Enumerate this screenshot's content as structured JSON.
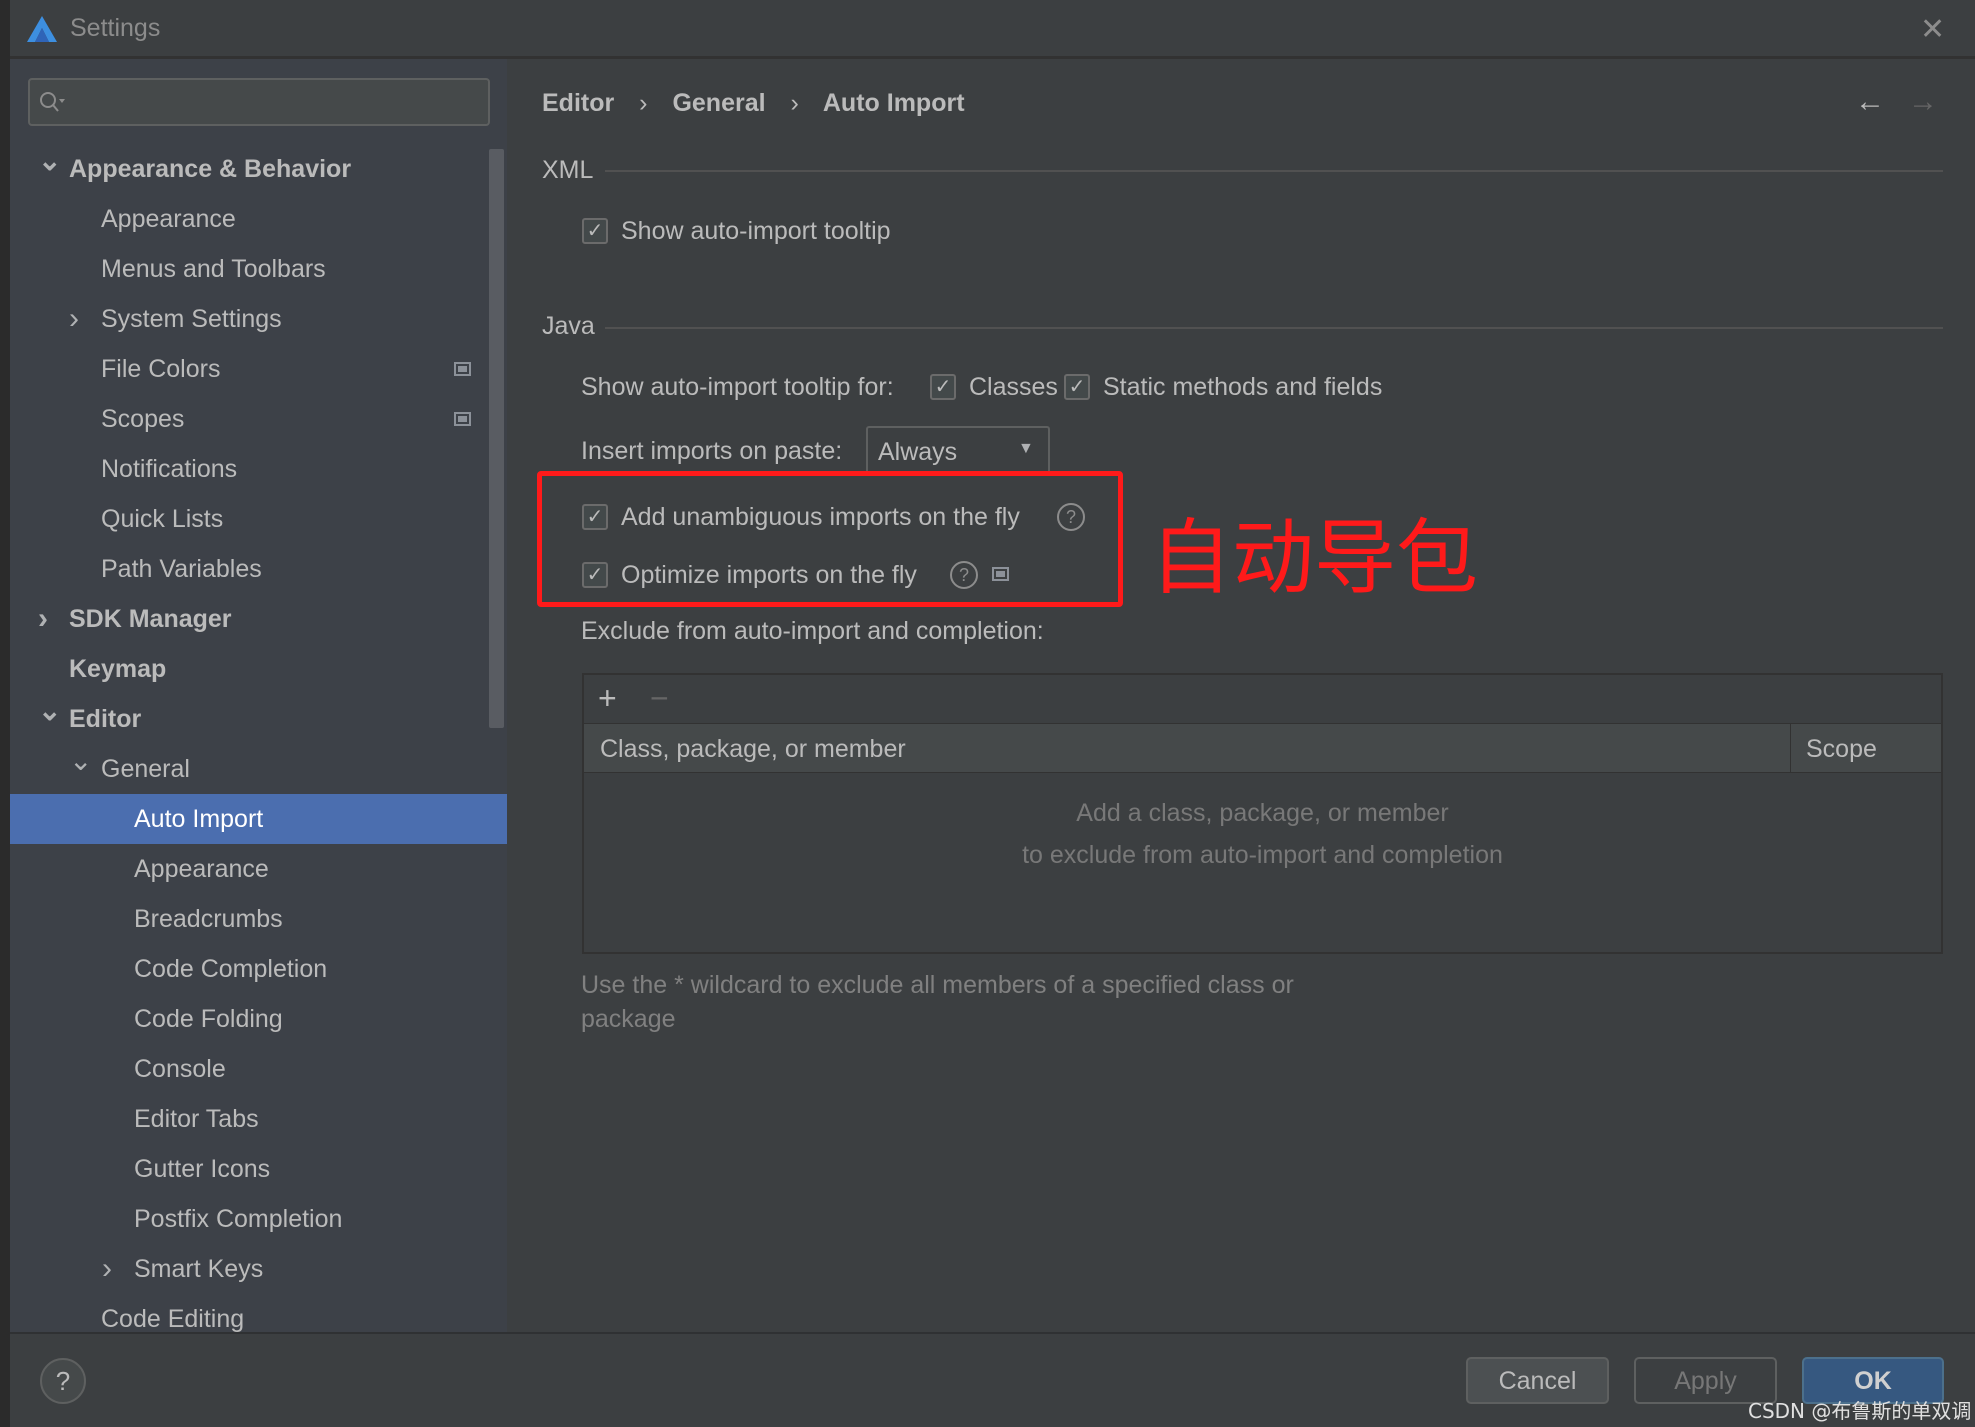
{
  "window": {
    "title": "Settings",
    "close_icon": "close-icon"
  },
  "search": {
    "placeholder": "",
    "value": ""
  },
  "sidebar": {
    "items": [
      {
        "label": "Appearance & Behavior",
        "level": 0,
        "bold": true,
        "arrow": "expanded"
      },
      {
        "label": "Appearance",
        "level": 1
      },
      {
        "label": "Menus and Toolbars",
        "level": 1
      },
      {
        "label": "System Settings",
        "level": 1,
        "arrow": "collapsed"
      },
      {
        "label": "File Colors",
        "level": 1,
        "icon": "project-scope-icon"
      },
      {
        "label": "Scopes",
        "level": 1,
        "icon": "project-scope-icon"
      },
      {
        "label": "Notifications",
        "level": 1
      },
      {
        "label": "Quick Lists",
        "level": 1
      },
      {
        "label": "Path Variables",
        "level": 1
      },
      {
        "label": "SDK Manager",
        "level": 0,
        "bold": true,
        "arrow": "collapsed"
      },
      {
        "label": "Keymap",
        "level": 0,
        "bold": true
      },
      {
        "label": "Editor",
        "level": 0,
        "bold": true,
        "arrow": "expanded"
      },
      {
        "label": "General",
        "level": 1,
        "arrow": "expanded"
      },
      {
        "label": "Auto Import",
        "level": 2,
        "selected": true
      },
      {
        "label": "Appearance",
        "level": 2
      },
      {
        "label": "Breadcrumbs",
        "level": 2
      },
      {
        "label": "Code Completion",
        "level": 2
      },
      {
        "label": "Code Folding",
        "level": 2
      },
      {
        "label": "Console",
        "level": 2
      },
      {
        "label": "Editor Tabs",
        "level": 2
      },
      {
        "label": "Gutter Icons",
        "level": 2
      },
      {
        "label": "Postfix Completion",
        "level": 2
      },
      {
        "label": "Smart Keys",
        "level": 2,
        "arrow": "collapsed"
      },
      {
        "label": "Code Editing",
        "level": 1
      }
    ]
  },
  "breadcrumb": [
    "Editor",
    "General",
    "Auto Import"
  ],
  "xml": {
    "header": "XML",
    "show_tooltip": {
      "label": "Show auto-import tooltip",
      "checked": true
    }
  },
  "java": {
    "header": "Java",
    "tooltip_for_label": "Show auto-import tooltip for:",
    "classes": {
      "label": "Classes",
      "checked": true
    },
    "static": {
      "label": "Static methods and fields",
      "checked": true
    },
    "paste_label": "Insert imports on paste:",
    "paste_value": "Always",
    "add_unambiguous": {
      "label": "Add unambiguous imports on the fly",
      "checked": true
    },
    "optimize": {
      "label": "Optimize imports on the fly",
      "checked": true
    },
    "exclude_label": "Exclude from auto-import and completion:",
    "table": {
      "columns": [
        "Class, package, or member",
        "Scope"
      ],
      "empty_line1": "Add a class, package, or member",
      "empty_line2": "to exclude from auto-import and completion"
    },
    "note_line1": "Use the * wildcard to exclude all members of a specified class or",
    "note_line2": "package"
  },
  "annotation": {
    "text": "自动导包",
    "color": "#ff1a1a"
  },
  "buttons": {
    "cancel": "Cancel",
    "apply": "Apply",
    "ok": "OK",
    "help": "?"
  },
  "watermark": "CSDN @布鲁斯的单双调",
  "colors": {
    "selection": "#4b6eaf",
    "ok": "#365880",
    "highlight": "#ff1a1a"
  }
}
